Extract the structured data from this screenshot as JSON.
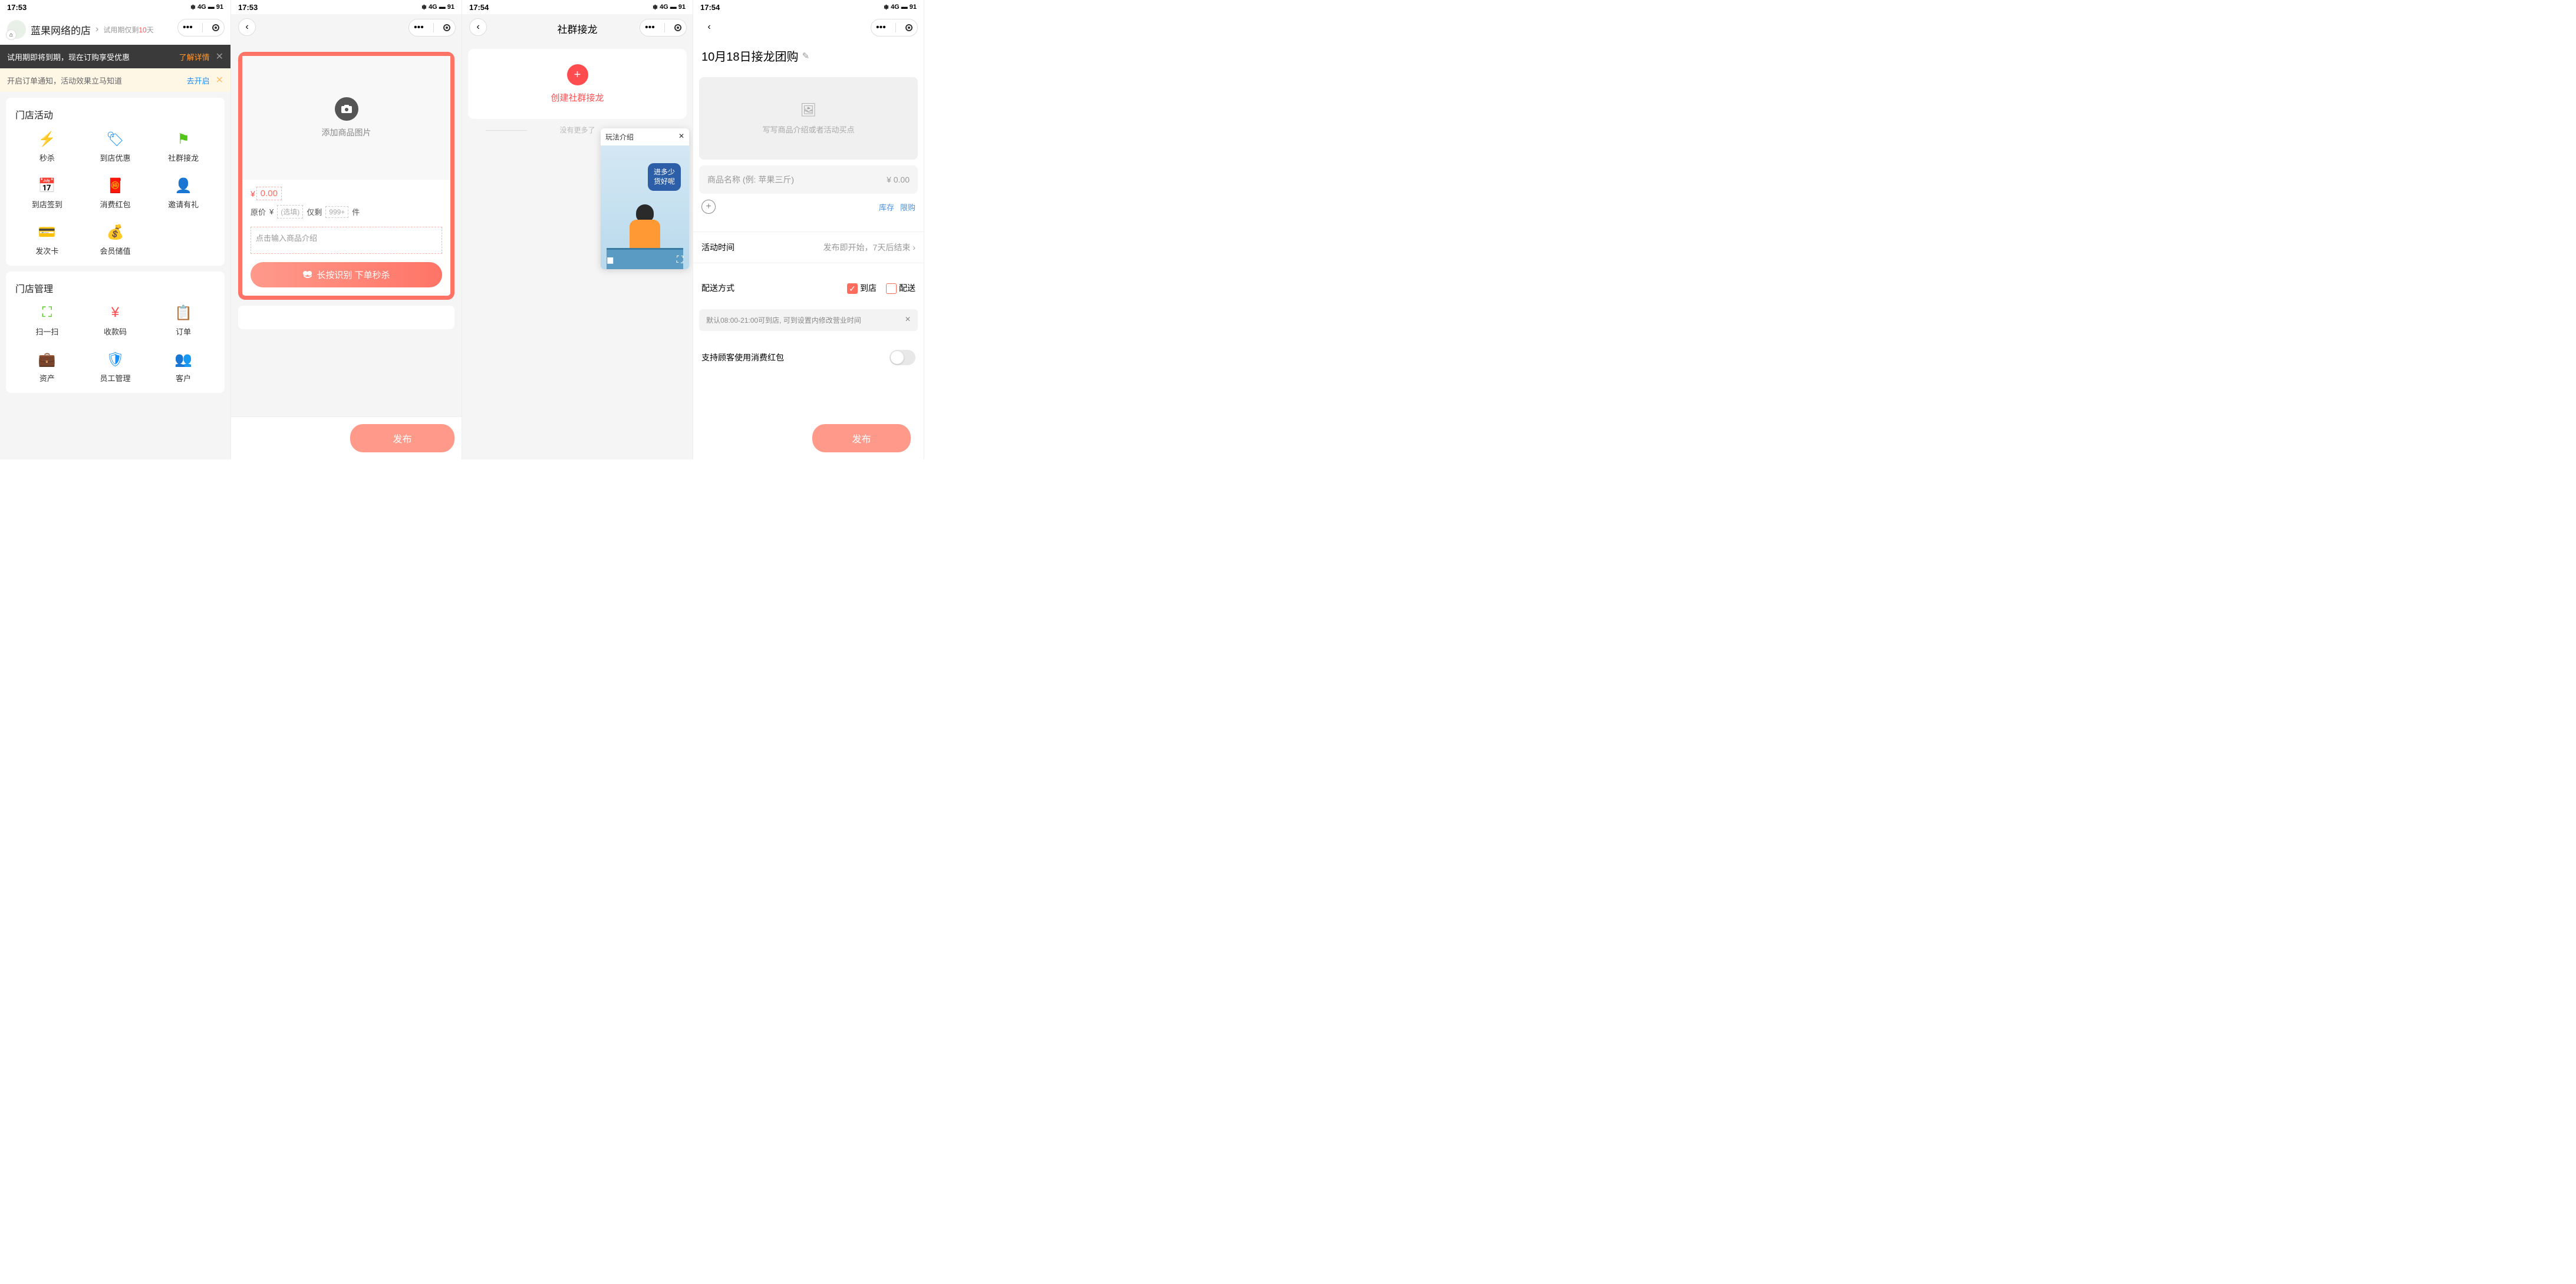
{
  "status": {
    "time1": "17:53",
    "time2": "17:54",
    "battery": "91",
    "signal": "4G"
  },
  "screen1": {
    "shop_name": "蓝果网络的店",
    "trial_prefix": "试用期仅剩",
    "trial_days": "10",
    "trial_suffix": "天",
    "banner1_text": "试用期即将到期，现在订购享受优惠",
    "banner1_link": "了解详情",
    "banner2_text": "开启订单通知，活动效果立马知道",
    "banner2_link": "去开启",
    "section1_title": "门店活动",
    "activities": [
      {
        "label": "秒杀",
        "icon": "⚡",
        "color": "#ff4d4f"
      },
      {
        "label": "到店优惠",
        "icon": "🏷",
        "color": "#1890ff"
      },
      {
        "label": "社群接龙",
        "icon": "⚑",
        "color": "#52c41a"
      },
      {
        "label": "到店签到",
        "icon": "📅",
        "color": "#ff4d4f"
      },
      {
        "label": "消费红包",
        "icon": "🧧",
        "color": "#ff4d4f"
      },
      {
        "label": "邀请有礼",
        "icon": "👤",
        "color": "#52c41a"
      },
      {
        "label": "发次卡",
        "icon": "💳",
        "color": "#1890ff"
      },
      {
        "label": "会员储值",
        "icon": "💰",
        "color": "#52c41a"
      }
    ],
    "section2_title": "门店管理",
    "manage": [
      {
        "label": "扫一扫",
        "icon": "⛶",
        "color": "#52c41a"
      },
      {
        "label": "收款码",
        "icon": "¥",
        "color": "#ff4d4f"
      },
      {
        "label": "订单",
        "icon": "📋",
        "color": "#ff4d4f"
      },
      {
        "label": "资产",
        "icon": "💼",
        "color": "#52c41a"
      },
      {
        "label": "员工管理",
        "icon": "🛡",
        "color": "#1890ff"
      },
      {
        "label": "客户",
        "icon": "👥",
        "color": "#1890ff"
      }
    ]
  },
  "screen2": {
    "add_image_text": "添加商品图片",
    "price_value": "0.00",
    "orig_label": "原价",
    "orig_placeholder": "(选填)",
    "stock_label": "仅剩",
    "stock_value": "999+",
    "stock_unit": "件",
    "desc_placeholder": "点击输入商品介绍",
    "long_btn": "长按识别 下单秒杀",
    "publish": "发布"
  },
  "screen3": {
    "title": "社群接龙",
    "create": "创建社群接龙",
    "no_more": "没有更多了",
    "popup_title": "玩法介绍",
    "bubble_text": "进多少\n货好呢"
  },
  "screen4": {
    "title": "10月18日接龙团购",
    "img_placeholder": "写写商品介绍或者活动买点",
    "name_placeholder": "商品名称 (例: 苹果三斤)",
    "price_text": "¥  0.00",
    "stock_link": "库存",
    "limit_link": "限购",
    "time_label": "活动时间",
    "time_value": "发布即开始，7天后结束",
    "delivery_label": "配送方式",
    "delivery_opt1": "到店",
    "delivery_opt2": "配送",
    "hours_text": "默认08:00-21:00可到店, 可到设置内修改营业时间",
    "redpack_label": "支持顾客使用消费红包",
    "publish": "发布"
  }
}
